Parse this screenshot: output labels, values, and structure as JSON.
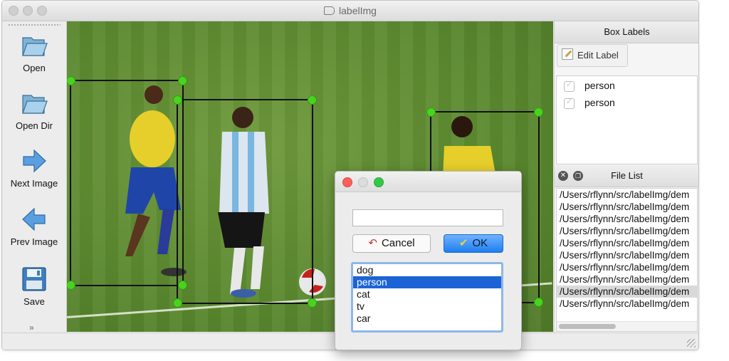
{
  "window": {
    "title": "labelImg"
  },
  "toolbar": {
    "items": [
      {
        "label": "Open",
        "icon": "folder-icon"
      },
      {
        "label": "Open Dir",
        "icon": "folder-icon"
      },
      {
        "label": "Next Image",
        "icon": "arrow-right-icon"
      },
      {
        "label": "Prev Image",
        "icon": "arrow-left-icon"
      },
      {
        "label": "Save",
        "icon": "floppy-disk-icon"
      }
    ],
    "more": "»"
  },
  "box_labels": {
    "header": "Box Labels",
    "edit_label": "Edit Label",
    "items": [
      {
        "label": "person",
        "checked": false
      },
      {
        "label": "person",
        "checked": false
      }
    ]
  },
  "file_list": {
    "header": "File List",
    "files": [
      "/Users/rflynn/src/labelImg/dem",
      "/Users/rflynn/src/labelImg/dem",
      "/Users/rflynn/src/labelImg/dem",
      "/Users/rflynn/src/labelImg/dem",
      "/Users/rflynn/src/labelImg/dem",
      "/Users/rflynn/src/labelImg/dem",
      "/Users/rflynn/src/labelImg/dem",
      "/Users/rflynn/src/labelImg/dem",
      "/Users/rflynn/src/labelImg/dem",
      "/Users/rflynn/src/labelImg/dem"
    ],
    "selected_index": 8
  },
  "dialog": {
    "input_value": "",
    "cancel_label": "Cancel",
    "ok_label": "OK",
    "options": [
      "dog",
      "person",
      "cat",
      "tv",
      "car"
    ],
    "selected_option": "person"
  },
  "colors": {
    "handle_green": "#49d31f",
    "bbox_black": "#111111",
    "selection_blue": "#1c64d5",
    "ok_button_blue": "#1f7fef"
  }
}
